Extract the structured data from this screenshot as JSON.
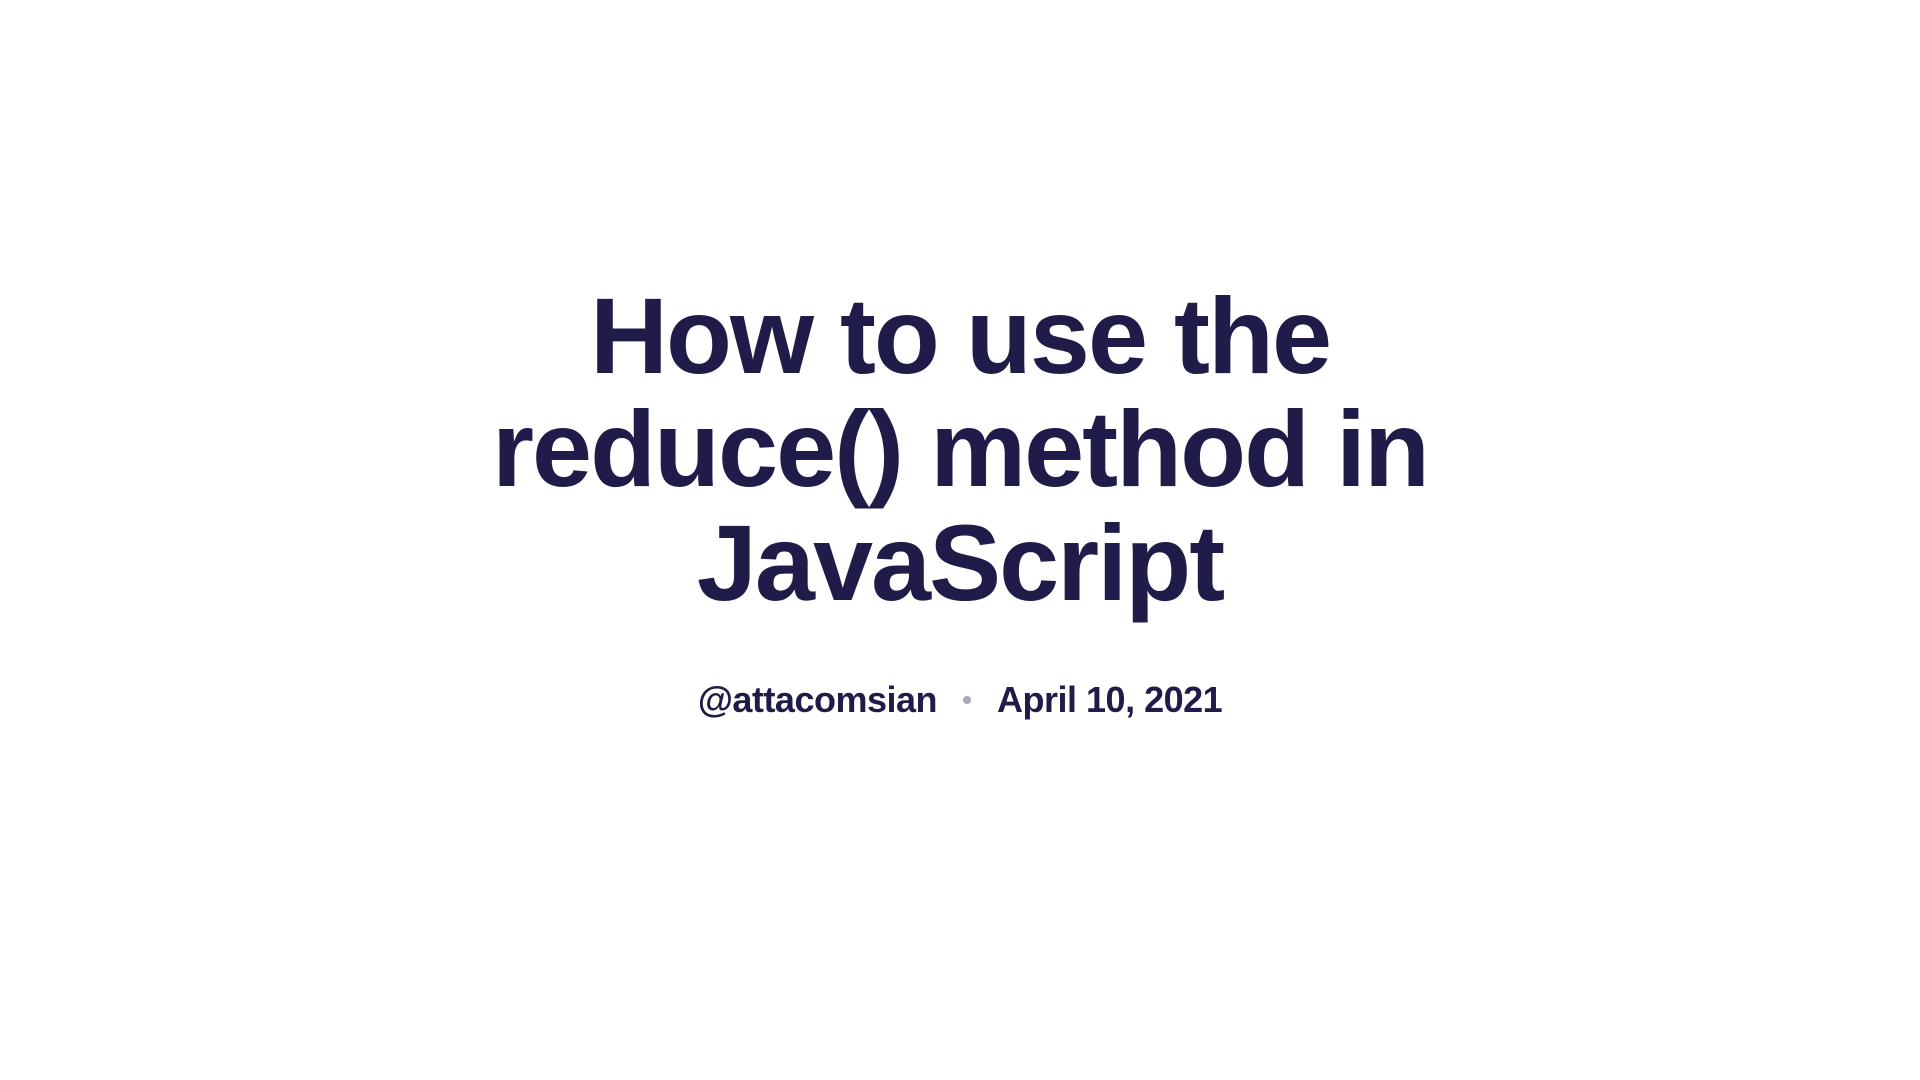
{
  "article": {
    "title": "How to use the reduce() method in JavaScript",
    "author": "@attacomsian",
    "date": "April 10, 2021"
  }
}
